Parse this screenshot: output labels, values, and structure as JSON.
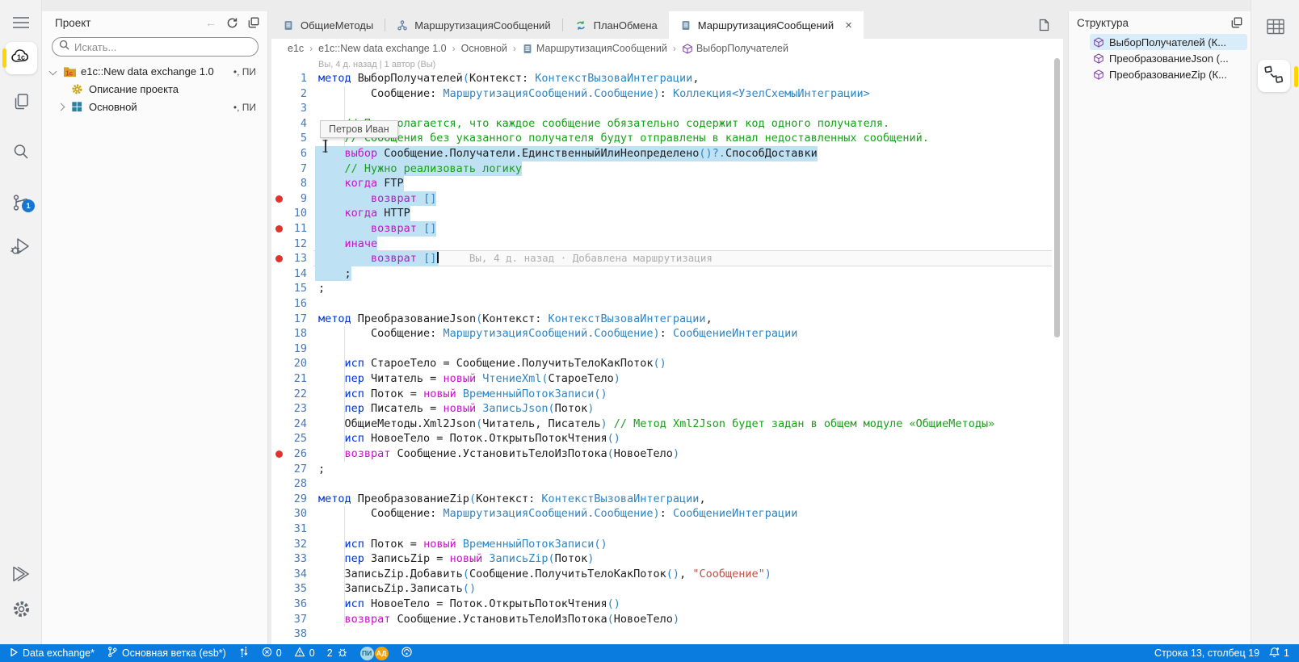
{
  "activity_bar": {
    "git_badge": "1"
  },
  "project_panel": {
    "title": "Проект",
    "search_placeholder": "Искать...",
    "tree": [
      {
        "label": "e1c::New data exchange 1.0",
        "icon": "folder1c",
        "badge": "•, ПИ",
        "chevron": "open",
        "level": 0
      },
      {
        "label": "Описание проекта",
        "icon": "gear",
        "badge": "",
        "chevron": "",
        "level": 1
      },
      {
        "label": "Основной",
        "icon": "module",
        "badge": "•, ПИ",
        "chevron": "closed",
        "level": 1
      }
    ]
  },
  "tabs": [
    {
      "label": "ОбщиеМетоды",
      "icon": "doc",
      "active": false,
      "closable": false
    },
    {
      "label": "МаршрутизацияСообщений",
      "icon": "flow",
      "active": false,
      "closable": false
    },
    {
      "label": "ПланОбмена",
      "icon": "exchange",
      "active": false,
      "closable": false
    },
    {
      "label": "МаршрутизацияСообщений",
      "icon": "doc",
      "active": true,
      "closable": true
    }
  ],
  "breadcrumb": [
    {
      "label": "e1c",
      "icon": ""
    },
    {
      "label": "e1c::New data exchange 1.0",
      "icon": ""
    },
    {
      "label": "Основной",
      "icon": ""
    },
    {
      "label": "МаршрутизацияСообщений",
      "icon": "doc"
    },
    {
      "label": "ВыборПолучателей",
      "icon": "cube"
    }
  ],
  "editor": {
    "codelens": "Вы, 4 д. назад | 1 автор (Вы)",
    "tooltip_author": "Петров Иван",
    "blame": "Вы, 4 д. назад · Добавлена маршрутизация",
    "indent_guides": [
      {
        "from": 2,
        "to": 14
      },
      {
        "from": 18,
        "to": 26
      },
      {
        "from": 30,
        "to": 37
      }
    ],
    "lines": [
      {
        "n": 1,
        "seg": [
          [
            "kw",
            "метод"
          ],
          [
            "txt",
            " ВыборПолучателей"
          ],
          [
            "pun",
            "("
          ],
          [
            "txt",
            "Контекст: "
          ],
          [
            "typ",
            "КонтекстВызоваИнтеграции"
          ],
          [
            "txt",
            ","
          ]
        ]
      },
      {
        "n": 2,
        "seg": [
          [
            "txt",
            "        Сообщение: "
          ],
          [
            "typ",
            "МаршрутизацияСообщений.Сообщение"
          ],
          [
            "pun",
            ")"
          ],
          [
            "txt",
            ": "
          ],
          [
            "typ",
            "Коллекция<УзелСхемыИнтеграции>"
          ]
        ]
      },
      {
        "n": 3,
        "seg": []
      },
      {
        "n": 4,
        "seg": [
          [
            "com",
            "    // Предполагается, что каждое сообщение обязательно содержит код одного получателя."
          ]
        ]
      },
      {
        "n": 5,
        "seg": [
          [
            "com",
            "    // Сообщения без указанного получателя будут отправлены в канал недоставленных сообщений."
          ]
        ]
      },
      {
        "n": 6,
        "sel": true,
        "seg": [
          [
            "txt",
            "    "
          ],
          [
            "ctl",
            "выбор"
          ],
          [
            "txt",
            " Сообщение.Получатели.ЕдинственныйИлиНеопределено"
          ],
          [
            "pun",
            "()?."
          ],
          [
            "txt",
            "СпособДоставки"
          ]
        ]
      },
      {
        "n": 7,
        "sel": true,
        "seg": [
          [
            "com",
            "    // Нужно реализовать логику"
          ]
        ]
      },
      {
        "n": 8,
        "sel": true,
        "seg": [
          [
            "txt",
            "    "
          ],
          [
            "ctl",
            "когда"
          ],
          [
            "txt",
            " FTP"
          ]
        ]
      },
      {
        "n": 9,
        "sel": true,
        "bp": true,
        "seg": [
          [
            "txt",
            "        "
          ],
          [
            "ctl",
            "возврат"
          ],
          [
            "txt",
            " "
          ],
          [
            "pun",
            "[]"
          ]
        ]
      },
      {
        "n": 10,
        "sel": true,
        "seg": [
          [
            "txt",
            "    "
          ],
          [
            "ctl",
            "когда"
          ],
          [
            "txt",
            " HTTP"
          ]
        ]
      },
      {
        "n": 11,
        "sel": true,
        "bp": true,
        "seg": [
          [
            "txt",
            "        "
          ],
          [
            "ctl",
            "возврат"
          ],
          [
            "txt",
            " "
          ],
          [
            "pun",
            "[]"
          ]
        ]
      },
      {
        "n": 12,
        "sel": true,
        "seg": [
          [
            "txt",
            "    "
          ],
          [
            "ctl",
            "иначе"
          ]
        ]
      },
      {
        "n": 13,
        "sel": true,
        "bp": true,
        "bulb": true,
        "caret": true,
        "current": true,
        "blame": true,
        "seg": [
          [
            "txt",
            "        "
          ],
          [
            "ctl",
            "возврат"
          ],
          [
            "txt",
            " "
          ],
          [
            "pun",
            "[]"
          ]
        ]
      },
      {
        "n": 14,
        "sel": true,
        "seg": [
          [
            "txt",
            "    ;"
          ]
        ]
      },
      {
        "n": 15,
        "seg": [
          [
            "txt",
            ";"
          ]
        ]
      },
      {
        "n": 16,
        "seg": []
      },
      {
        "n": 17,
        "seg": [
          [
            "kw",
            "метод"
          ],
          [
            "txt",
            " ПреобразованиеJson"
          ],
          [
            "pun",
            "("
          ],
          [
            "txt",
            "Контекст: "
          ],
          [
            "typ",
            "КонтекстВызоваИнтеграции"
          ],
          [
            "txt",
            ","
          ]
        ]
      },
      {
        "n": 18,
        "seg": [
          [
            "txt",
            "        Сообщение: "
          ],
          [
            "typ",
            "МаршрутизацияСообщений.Сообщение"
          ],
          [
            "pun",
            ")"
          ],
          [
            "txt",
            ": "
          ],
          [
            "typ",
            "СообщениеИнтеграции"
          ]
        ]
      },
      {
        "n": 19,
        "seg": []
      },
      {
        "n": 20,
        "seg": [
          [
            "txt",
            "    "
          ],
          [
            "kw",
            "исп"
          ],
          [
            "txt",
            " СтароеТело = Сообщение.ПолучитьТелоКакПоток"
          ],
          [
            "pun",
            "()"
          ]
        ]
      },
      {
        "n": 21,
        "seg": [
          [
            "txt",
            "    "
          ],
          [
            "kw",
            "пер"
          ],
          [
            "txt",
            " Читатель = "
          ],
          [
            "ctl",
            "новый"
          ],
          [
            "typ",
            " ЧтениеXml"
          ],
          [
            "pun",
            "("
          ],
          [
            "txt",
            "СтароеТело"
          ],
          [
            "pun",
            ")"
          ]
        ]
      },
      {
        "n": 22,
        "seg": [
          [
            "txt",
            "    "
          ],
          [
            "kw",
            "исп"
          ],
          [
            "txt",
            " Поток = "
          ],
          [
            "ctl",
            "новый"
          ],
          [
            "typ",
            " ВременныйПотокЗаписи"
          ],
          [
            "pun",
            "()"
          ]
        ]
      },
      {
        "n": 23,
        "seg": [
          [
            "txt",
            "    "
          ],
          [
            "kw",
            "пер"
          ],
          [
            "txt",
            " Писатель = "
          ],
          [
            "ctl",
            "новый"
          ],
          [
            "typ",
            " ЗаписьJson"
          ],
          [
            "pun",
            "("
          ],
          [
            "txt",
            "Поток"
          ],
          [
            "pun",
            ")"
          ]
        ]
      },
      {
        "n": 24,
        "seg": [
          [
            "txt",
            "    ОбщиеМетоды.Xml2Json"
          ],
          [
            "pun",
            "("
          ],
          [
            "txt",
            "Читатель, Писатель"
          ],
          [
            "pun",
            ")"
          ],
          [
            "com",
            " // Метод Xml2Json будет задан в общем модуле «ОбщиеМетоды»"
          ]
        ]
      },
      {
        "n": 25,
        "seg": [
          [
            "txt",
            "    "
          ],
          [
            "kw",
            "исп"
          ],
          [
            "txt",
            " НовоеТело = Поток.ОткрытьПотокЧтения"
          ],
          [
            "pun",
            "()"
          ]
        ]
      },
      {
        "n": 26,
        "bp": true,
        "seg": [
          [
            "txt",
            "    "
          ],
          [
            "ctl",
            "возврат"
          ],
          [
            "txt",
            " Сообщение.УстановитьТелоИзПотока"
          ],
          [
            "pun",
            "("
          ],
          [
            "txt",
            "НовоеТело"
          ],
          [
            "pun",
            ")"
          ]
        ]
      },
      {
        "n": 27,
        "seg": [
          [
            "txt",
            ";"
          ]
        ]
      },
      {
        "n": 28,
        "seg": []
      },
      {
        "n": 29,
        "seg": [
          [
            "kw",
            "метод"
          ],
          [
            "txt",
            " ПреобразованиеZip"
          ],
          [
            "pun",
            "("
          ],
          [
            "txt",
            "Контекст: "
          ],
          [
            "typ",
            "КонтекстВызоваИнтеграции"
          ],
          [
            "txt",
            ","
          ]
        ]
      },
      {
        "n": 30,
        "seg": [
          [
            "txt",
            "        Сообщение: "
          ],
          [
            "typ",
            "МаршрутизацияСообщений.Сообщение"
          ],
          [
            "pun",
            ")"
          ],
          [
            "txt",
            ": "
          ],
          [
            "typ",
            "СообщениеИнтеграции"
          ]
        ]
      },
      {
        "n": 31,
        "seg": []
      },
      {
        "n": 32,
        "seg": [
          [
            "txt",
            "    "
          ],
          [
            "kw",
            "исп"
          ],
          [
            "txt",
            " Поток = "
          ],
          [
            "ctl",
            "новый"
          ],
          [
            "typ",
            " ВременныйПотокЗаписи"
          ],
          [
            "pun",
            "()"
          ]
        ]
      },
      {
        "n": 33,
        "seg": [
          [
            "txt",
            "    "
          ],
          [
            "kw",
            "пер"
          ],
          [
            "txt",
            " ЗаписьZip = "
          ],
          [
            "ctl",
            "новый"
          ],
          [
            "typ",
            " ЗаписьZip"
          ],
          [
            "pun",
            "("
          ],
          [
            "txt",
            "Поток"
          ],
          [
            "pun",
            ")"
          ]
        ]
      },
      {
        "n": 34,
        "seg": [
          [
            "txt",
            "    ЗаписьZip.Добавить"
          ],
          [
            "pun",
            "("
          ],
          [
            "txt",
            "Сообщение.ПолучитьТелоКакПоток"
          ],
          [
            "pun",
            "()"
          ],
          [
            "txt",
            ", "
          ],
          [
            "str",
            "\"Сообщение\""
          ],
          [
            "pun",
            ")"
          ]
        ]
      },
      {
        "n": 35,
        "seg": [
          [
            "txt",
            "    ЗаписьZip.Записать"
          ],
          [
            "pun",
            "()"
          ]
        ]
      },
      {
        "n": 36,
        "seg": [
          [
            "txt",
            "    "
          ],
          [
            "kw",
            "исп"
          ],
          [
            "txt",
            " НовоеТело = Поток.ОткрытьПотокЧтения"
          ],
          [
            "pun",
            "()"
          ]
        ]
      },
      {
        "n": 37,
        "seg": [
          [
            "txt",
            "    "
          ],
          [
            "ctl",
            "возврат"
          ],
          [
            "txt",
            " Сообщение.УстановитьТелоИзПотока"
          ],
          [
            "pun",
            "("
          ],
          [
            "txt",
            "НовоеТело"
          ],
          [
            "pun",
            ")"
          ]
        ]
      },
      {
        "n": 38,
        "seg": []
      }
    ]
  },
  "structure_panel": {
    "title": "Структура",
    "items": [
      {
        "label": "ВыборПолучателей (К...",
        "selected": true
      },
      {
        "label": "ПреобразованиеJson (...",
        "selected": false
      },
      {
        "label": "ПреобразованиеZip (К...",
        "selected": false
      }
    ]
  },
  "status_bar": {
    "run": "Data exchange*",
    "branch": "Основная ветка (esb*)",
    "errors": "0",
    "warnings": "0",
    "issues": "2",
    "avatars": [
      "ПИ",
      "АД"
    ],
    "cursor_position": "Строка 13, столбец 19",
    "notifications": "1"
  }
}
